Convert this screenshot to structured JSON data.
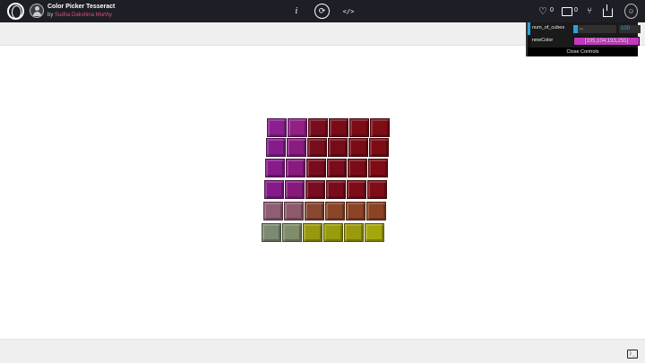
{
  "app": {
    "title": "Color Picker Tesseract",
    "by_prefix": "by",
    "author": "Sudha Dakshina Murthy"
  },
  "topbar": {
    "info_label": "i",
    "rerun_label": "⟳",
    "code_label": "</>",
    "like_count": "0",
    "comment_count": "0",
    "heart_glyph": "♡",
    "fork_glyph": "⑂",
    "user_glyph": "☺"
  },
  "controls": {
    "num_of_cubes_label": "num_of_cubes",
    "num_of_cubes_value": "100",
    "num_of_cubes_fraction": 0.1,
    "slider_grip": "↔",
    "new_color_label": "newColor",
    "new_color_value": "[195,104,193,255]",
    "new_color_swatch": "#c539c1",
    "close_label": "Close Controls",
    "accent_color": "#2fa1d6"
  },
  "footer": {
    "console_glyph": "⟩_"
  },
  "scene": {
    "cube_rows": [
      [
        "#8c1f8f",
        "#921f86",
        "#7a0d1d",
        "#7a0c18",
        "#7c0c16",
        "#7e0d16"
      ],
      [
        "#861c8b",
        "#8a1b80",
        "#780d1e",
        "#770c19",
        "#7a0c16",
        "#7e0c15"
      ],
      [
        "#861b8a",
        "#8a1a80",
        "#780c1e",
        "#780c1a",
        "#7b0c16",
        "#7f0c15"
      ],
      [
        "#841b89",
        "#881a7e",
        "#790c1f",
        "#790c1b",
        "#7d0c18",
        "#800c17"
      ],
      [
        "#8e5e74",
        "#8f5a6c",
        "#8a4731",
        "#8b4628",
        "#8d4426",
        "#8c4324"
      ],
      [
        "#7b8a71",
        "#808c6a",
        "#98990e",
        "#999c0c",
        "#9b9a0c",
        "#a5a60c"
      ]
    ]
  }
}
